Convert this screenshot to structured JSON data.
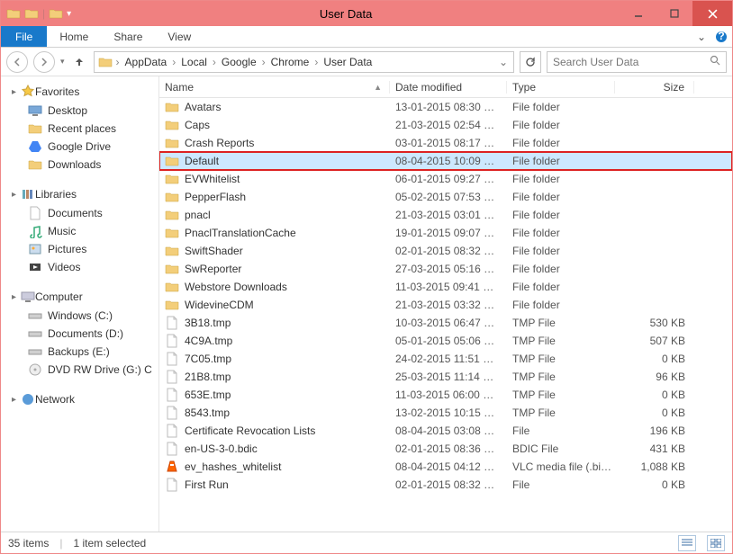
{
  "window": {
    "title": "User Data"
  },
  "menubar": {
    "file": "File",
    "items": [
      "Home",
      "Share",
      "View"
    ]
  },
  "breadcrumb": [
    "AppData",
    "Local",
    "Google",
    "Chrome",
    "User Data"
  ],
  "search": {
    "placeholder": "Search User Data"
  },
  "sidebar": {
    "favorites": {
      "label": "Favorites",
      "items": [
        "Desktop",
        "Recent places",
        "Google Drive",
        "Downloads"
      ]
    },
    "libraries": {
      "label": "Libraries",
      "items": [
        "Documents",
        "Music",
        "Pictures",
        "Videos"
      ]
    },
    "computer": {
      "label": "Computer",
      "items": [
        "Windows (C:)",
        "Documents (D:)",
        "Backups (E:)",
        "DVD RW Drive (G:) C"
      ]
    },
    "network": {
      "label": "Network"
    }
  },
  "columns": {
    "name": "Name",
    "date": "Date modified",
    "type": "Type",
    "size": "Size"
  },
  "files": [
    {
      "icon": "folder",
      "name": "Avatars",
      "date": "13-01-2015 08:30 …",
      "type": "File folder",
      "size": "",
      "selected": false
    },
    {
      "icon": "folder",
      "name": "Caps",
      "date": "21-03-2015 02:54 …",
      "type": "File folder",
      "size": "",
      "selected": false
    },
    {
      "icon": "folder",
      "name": "Crash Reports",
      "date": "03-01-2015 08:17 …",
      "type": "File folder",
      "size": "",
      "selected": false
    },
    {
      "icon": "folder",
      "name": "Default",
      "date": "08-04-2015 10:09 …",
      "type": "File folder",
      "size": "",
      "selected": true,
      "highlight": true
    },
    {
      "icon": "folder",
      "name": "EVWhitelist",
      "date": "06-01-2015 09:27 …",
      "type": "File folder",
      "size": "",
      "selected": false
    },
    {
      "icon": "folder",
      "name": "PepperFlash",
      "date": "05-02-2015 07:53 …",
      "type": "File folder",
      "size": "",
      "selected": false
    },
    {
      "icon": "folder",
      "name": "pnacl",
      "date": "21-03-2015 03:01 …",
      "type": "File folder",
      "size": "",
      "selected": false
    },
    {
      "icon": "folder",
      "name": "PnaclTranslationCache",
      "date": "19-01-2015 09:07 …",
      "type": "File folder",
      "size": "",
      "selected": false
    },
    {
      "icon": "folder",
      "name": "SwiftShader",
      "date": "02-01-2015 08:32 …",
      "type": "File folder",
      "size": "",
      "selected": false
    },
    {
      "icon": "folder",
      "name": "SwReporter",
      "date": "27-03-2015 05:16 …",
      "type": "File folder",
      "size": "",
      "selected": false
    },
    {
      "icon": "folder",
      "name": "Webstore Downloads",
      "date": "11-03-2015 09:41 …",
      "type": "File folder",
      "size": "",
      "selected": false
    },
    {
      "icon": "folder",
      "name": "WidevineCDM",
      "date": "21-03-2015 03:32 …",
      "type": "File folder",
      "size": "",
      "selected": false
    },
    {
      "icon": "file",
      "name": "3B18.tmp",
      "date": "10-03-2015 06:47 …",
      "type": "TMP File",
      "size": "530 KB",
      "selected": false
    },
    {
      "icon": "file",
      "name": "4C9A.tmp",
      "date": "05-01-2015 05:06 …",
      "type": "TMP File",
      "size": "507 KB",
      "selected": false
    },
    {
      "icon": "file",
      "name": "7C05.tmp",
      "date": "24-02-2015 11:51 …",
      "type": "TMP File",
      "size": "0 KB",
      "selected": false
    },
    {
      "icon": "file",
      "name": "21B8.tmp",
      "date": "25-03-2015 11:14 …",
      "type": "TMP File",
      "size": "96 KB",
      "selected": false
    },
    {
      "icon": "file",
      "name": "653E.tmp",
      "date": "11-03-2015 06:00 …",
      "type": "TMP File",
      "size": "0 KB",
      "selected": false
    },
    {
      "icon": "file",
      "name": "8543.tmp",
      "date": "13-02-2015 10:15 …",
      "type": "TMP File",
      "size": "0 KB",
      "selected": false
    },
    {
      "icon": "file",
      "name": "Certificate Revocation Lists",
      "date": "08-04-2015 03:08 …",
      "type": "File",
      "size": "196 KB",
      "selected": false
    },
    {
      "icon": "file",
      "name": "en-US-3-0.bdic",
      "date": "02-01-2015 08:36 …",
      "type": "BDIC File",
      "size": "431 KB",
      "selected": false
    },
    {
      "icon": "vlc",
      "name": "ev_hashes_whitelist",
      "date": "08-04-2015 04:12 …",
      "type": "VLC media file (.bi…",
      "size": "1,088 KB",
      "selected": false
    },
    {
      "icon": "file",
      "name": "First Run",
      "date": "02-01-2015 08:32 …",
      "type": "File",
      "size": "0 KB",
      "selected": false
    }
  ],
  "status": {
    "items": "35 items",
    "selected": "1 item selected"
  }
}
